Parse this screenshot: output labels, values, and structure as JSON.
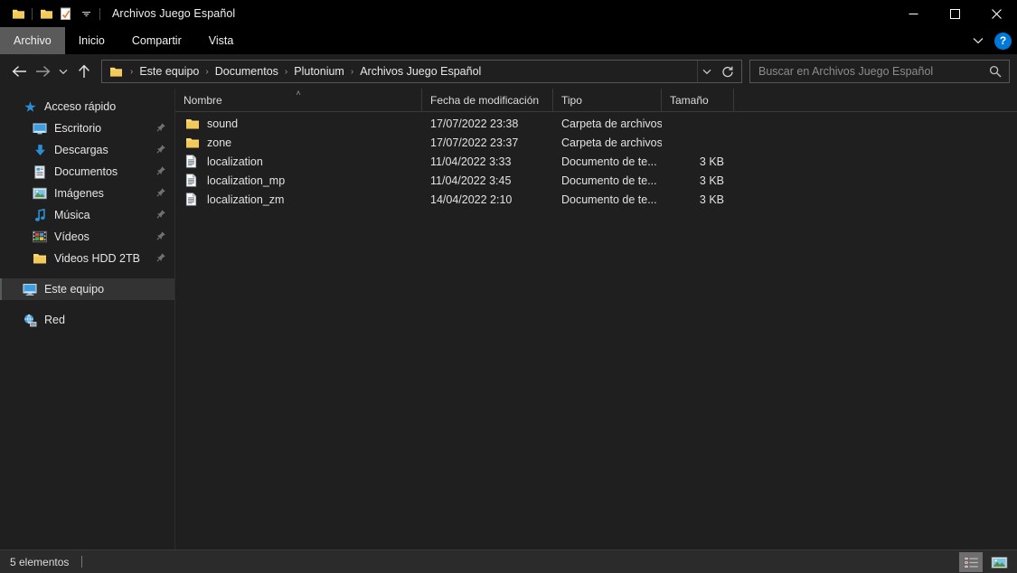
{
  "window": {
    "title": "Archivos Juego Español",
    "quick_access": [
      {
        "name": "folder-icon",
        "label": "Propiedades carpeta"
      },
      {
        "name": "folder-icon-2",
        "label": "Nueva carpeta"
      },
      {
        "name": "properties-check-icon",
        "label": "Propiedades"
      }
    ],
    "controls": {
      "minimize": "—",
      "maximize": "☐",
      "close": "✕"
    }
  },
  "ribbon": {
    "tabs": [
      {
        "label": "Archivo",
        "active": true
      },
      {
        "label": "Inicio",
        "active": false
      },
      {
        "label": "Compartir",
        "active": false
      },
      {
        "label": "Vista",
        "active": false
      }
    ],
    "expand_label": "Expandir la cinta de opciones",
    "help_label": "?"
  },
  "address": {
    "back_label": "Atrás",
    "forward_label": "Adelante",
    "recent_label": "Ubicaciones recientes",
    "up_label": "Arriba",
    "breadcrumbs": [
      {
        "label": "Este equipo"
      },
      {
        "label": "Documentos"
      },
      {
        "label": "Plutonium"
      },
      {
        "label": "Archivos Juego Español"
      }
    ],
    "separator": "›",
    "dropdown_label": "∨",
    "refresh_label": "↻"
  },
  "search": {
    "placeholder": "Buscar en Archivos Juego Español",
    "value": ""
  },
  "sidebar": {
    "items": [
      {
        "label": "Acceso rápido",
        "icon": "star-icon",
        "level": "group",
        "pinned": false,
        "selected": false
      },
      {
        "label": "Escritorio",
        "icon": "desktop-icon",
        "level": "child",
        "pinned": true,
        "selected": false
      },
      {
        "label": "Descargas",
        "icon": "download-icon",
        "level": "child",
        "pinned": true,
        "selected": false
      },
      {
        "label": "Documentos",
        "icon": "documents-icon",
        "level": "child",
        "pinned": true,
        "selected": false
      },
      {
        "label": "Imágenes",
        "icon": "pictures-icon",
        "level": "child",
        "pinned": true,
        "selected": false
      },
      {
        "label": "Música",
        "icon": "music-icon",
        "level": "child",
        "pinned": true,
        "selected": false
      },
      {
        "label": "Vídeos",
        "icon": "video-icon",
        "level": "child",
        "pinned": true,
        "selected": false
      },
      {
        "label": "Videos HDD 2TB",
        "icon": "folder-icon",
        "level": "child",
        "pinned": true,
        "selected": false
      },
      {
        "label": "Este equipo",
        "icon": "computer-icon",
        "level": "group",
        "pinned": false,
        "selected": true
      },
      {
        "label": "Red",
        "icon": "network-icon",
        "level": "group",
        "pinned": false,
        "selected": false
      }
    ]
  },
  "filelist": {
    "columns": [
      {
        "label": "Nombre",
        "sorted": "asc"
      },
      {
        "label": "Fecha de modificación",
        "sorted": ""
      },
      {
        "label": "Tipo",
        "sorted": ""
      },
      {
        "label": "Tamaño",
        "sorted": ""
      }
    ],
    "sort_mark": "˄",
    "rows": [
      {
        "name": "sound",
        "date": "17/07/2022 23:38",
        "type": "Carpeta de archivos",
        "size": "",
        "icon": "folder-icon"
      },
      {
        "name": "zone",
        "date": "17/07/2022 23:37",
        "type": "Carpeta de archivos",
        "size": "",
        "icon": "folder-icon"
      },
      {
        "name": "localization",
        "date": "11/04/2022 3:33",
        "type": "Documento de te...",
        "size": "3 KB",
        "icon": "text-file-icon"
      },
      {
        "name": "localization_mp",
        "date": "11/04/2022 3:45",
        "type": "Documento de te...",
        "size": "3 KB",
        "icon": "text-file-icon"
      },
      {
        "name": "localization_zm",
        "date": "14/04/2022 2:10",
        "type": "Documento de te...",
        "size": "3 KB",
        "icon": "text-file-icon"
      }
    ]
  },
  "statusbar": {
    "item_count": "5 elementos",
    "details_view_label": "Vista Detalles",
    "icons_view_label": "Vista Iconos grandes"
  },
  "colors": {
    "window_bg": "#1f1f1f",
    "titlebar_bg": "#000000",
    "accent_blue": "#0078d7",
    "folder_yellow": "#fcd770",
    "text": "#e6e6e6",
    "status_bg": "#2b2b2b"
  }
}
